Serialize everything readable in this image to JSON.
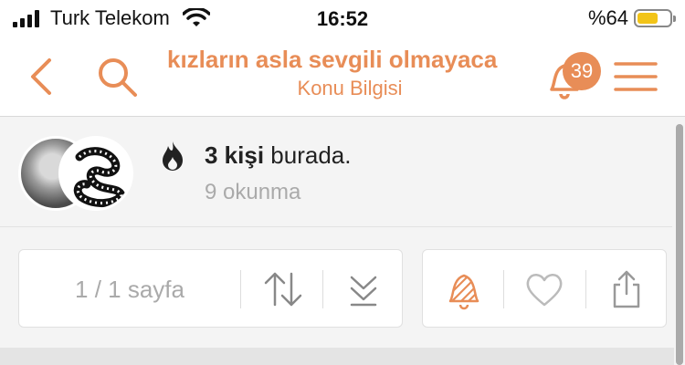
{
  "status_bar": {
    "carrier": "Turk Telekom",
    "time": "16:52",
    "battery_text": "%64",
    "battery_level": 0.64,
    "signal_icon": "signal-bars-icon",
    "wifi_icon": "wifi-icon"
  },
  "nav": {
    "title": "kızların asla sevgili olmayaca",
    "subtitle": "Konu Bilgisi",
    "notification_count": "39",
    "icons": {
      "back": "chevron-left-icon",
      "search": "search-icon",
      "bell": "bell-icon",
      "menu": "hamburger-menu-icon"
    },
    "accent_color": "#e88d57"
  },
  "viewers": {
    "count": "3 kişi",
    "here_suffix": "burada.",
    "reads": "9 okunma",
    "icon": "fire-icon"
  },
  "toolbar": {
    "pager_label": "1 / 1 sayfa",
    "icons": [
      "sort-arrows-icon",
      "jump-to-bottom-icon",
      "subscribe-bell-icon",
      "heart-icon",
      "share-icon"
    ]
  }
}
